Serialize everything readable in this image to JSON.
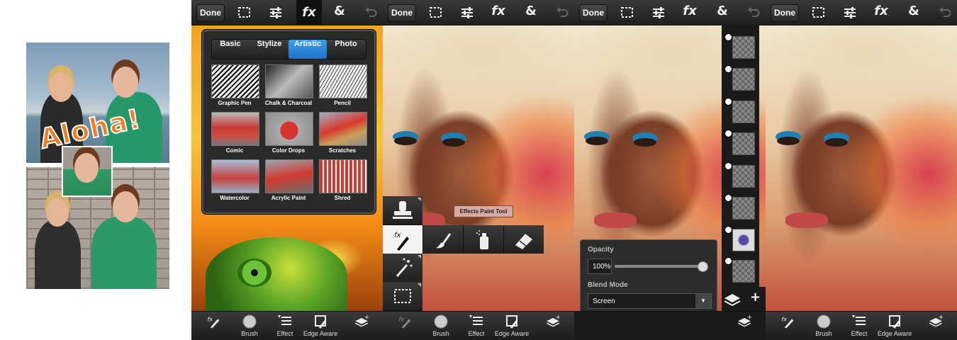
{
  "collage": {
    "overlay_text": "Aloha!"
  },
  "toolbar": {
    "done_label": "Done",
    "icons": [
      "selection-icon",
      "adjustments-icon",
      "fx-icon",
      "ampersand-icon",
      "undo-icon"
    ],
    "fx_glyph": "fx",
    "amp_glyph": "&"
  },
  "effects_popup": {
    "tabs": [
      "Basic",
      "Stylize",
      "Artistic",
      "Photo"
    ],
    "active_tab": "Artistic",
    "effects": [
      "Graphic Pen",
      "Chalk & Charcoal",
      "Pencil",
      "Comic",
      "Color Drops",
      "Scratches",
      "Watercolor",
      "Acrylic Paint",
      "Shred"
    ]
  },
  "bottombar": {
    "brush_label": "Brush",
    "effect_label": "Effect",
    "edge_aware_label": "Edge Aware"
  },
  "tool_palette": {
    "tooltip": "Effects Paint Tool"
  },
  "blend_panel": {
    "opacity_label": "Opacity",
    "opacity_value": "100%",
    "opacity_fraction": 1.0,
    "blend_mode_label": "Blend Mode",
    "blend_mode_value": "Screen"
  },
  "colors": {
    "accent": "#1f72c9",
    "aloha": "#f47b20"
  }
}
